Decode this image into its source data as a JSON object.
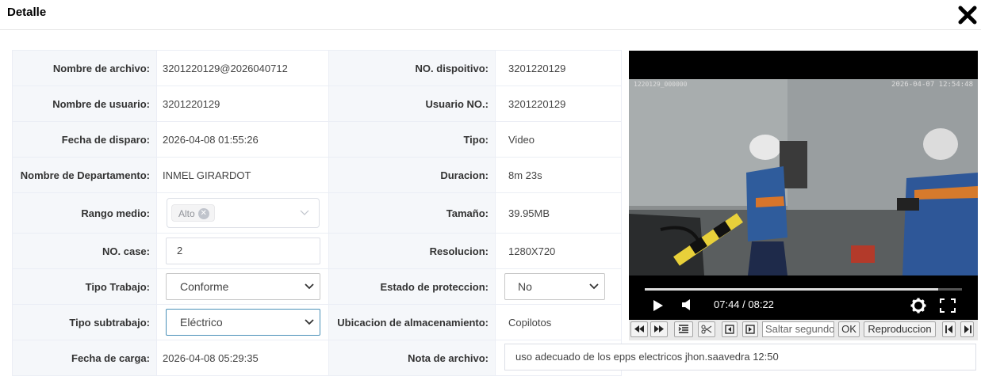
{
  "dialog": {
    "title": "Detalle"
  },
  "form": {
    "nombre_archivo": {
      "label": "Nombre de archivo:",
      "value": "3201220129@2026040712"
    },
    "no_dispositivo": {
      "label": "NO. dispoitivo:",
      "value": "3201220129"
    },
    "nombre_usuario": {
      "label": "Nombre de usuario:",
      "value": "3201220129"
    },
    "usuario_no": {
      "label": "Usuario NO.:",
      "value": "3201220129"
    },
    "fecha_disparo": {
      "label": "Fecha de disparo:",
      "value": "2026-04-08 01:55:26"
    },
    "tipo": {
      "label": "Tipo:",
      "value": "Video"
    },
    "departamento": {
      "label": "Nombre de Departamento:",
      "value": "INMEL GIRARDOT"
    },
    "duracion": {
      "label": "Duracion:",
      "value": "8m 23s"
    },
    "rango_medio": {
      "label": "Rango medio:",
      "tag": "Alto"
    },
    "tamano": {
      "label": "Tamaño:",
      "value": "39.95MB"
    },
    "no_case": {
      "label": "NO. case:",
      "value": "2"
    },
    "resolucion": {
      "label": "Resolucion:",
      "value": "1280X720"
    },
    "tipo_trabajo": {
      "label": "Tipo Trabajo:",
      "value": "Conforme"
    },
    "estado_proteccion": {
      "label": "Estado de proteccion:",
      "value": "No"
    },
    "tipo_subtrabajo": {
      "label": "Tipo subtrabajo:",
      "value": "Eléctrico"
    },
    "ubicacion": {
      "label": "Ubicacion de almacenamiento:",
      "value": "Copilotos"
    },
    "fecha_carga": {
      "label": "Fecha de carga:",
      "value": "2026-04-08 05:29:35"
    },
    "nota_archivo": {
      "label": "Nota de archivo:",
      "value": "uso adecuado de los epps electricos jhon.saavedra 12:50"
    }
  },
  "video": {
    "osd_left": "1220129_000000",
    "osd_right": "2026-04-07 12:54:48",
    "current_time": "07:44",
    "total_time": "08:22",
    "time_display": "07:44 / 08:22",
    "progress": 0.925
  },
  "video_toolbar": {
    "seek_placeholder": "Saltar segundos",
    "ok_label": "OK",
    "playback_label": "Reproduccion"
  }
}
